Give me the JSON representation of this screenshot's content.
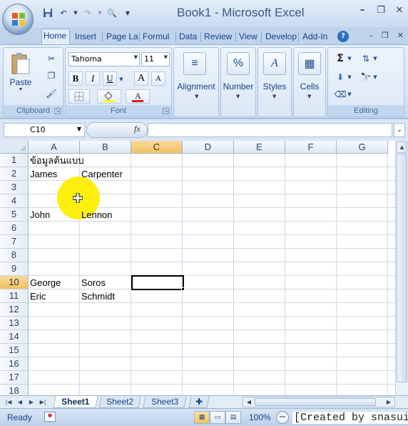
{
  "window": {
    "title": "Book1 - Microsoft Excel"
  },
  "ribbon_tabs": [
    "Home",
    "Insert",
    "Page La",
    "Formul",
    "Data",
    "Review",
    "View",
    "Develop",
    "Add-In"
  ],
  "ribbon": {
    "clipboard": {
      "paste_label": "Paste",
      "group_label": "Clipboard"
    },
    "font": {
      "font_name": "Tahoma",
      "font_size": "11",
      "group_label": "Font",
      "bold": "B",
      "italic": "I",
      "underline": "U",
      "grow": "A",
      "shrink": "A"
    },
    "alignment": {
      "label": "Alignment"
    },
    "number": {
      "label": "Number",
      "icon_text": "%"
    },
    "styles": {
      "label": "Styles"
    },
    "cells": {
      "label": "Cells"
    },
    "editing": {
      "group_label": "Editing",
      "sum_glyph": "Σ"
    }
  },
  "formula_bar": {
    "name_box": "C10",
    "fx_label": "fx",
    "formula": ""
  },
  "grid": {
    "columns": [
      "A",
      "B",
      "C",
      "D",
      "E",
      "F",
      "G"
    ],
    "selected_column": "C",
    "rows": [
      "1",
      "2",
      "3",
      "4",
      "5",
      "6",
      "7",
      "8",
      "9",
      "10",
      "11",
      "12",
      "13",
      "14",
      "15",
      "16",
      "17",
      "18"
    ],
    "selected_row": "10",
    "cells": {
      "A1": "ข้อมูลต้นแบบ",
      "A2": "James",
      "B2": "Carpenter",
      "A5": "John",
      "B5": "Lennon",
      "A10": "George",
      "B10": "Soros",
      "A11": "Eric",
      "B11": "Schmidt"
    }
  },
  "sheets": {
    "tabs": [
      "Sheet1",
      "Sheet2",
      "Sheet3"
    ],
    "active": "Sheet1"
  },
  "status": {
    "ready": "Ready",
    "zoom": "100%",
    "watermark": "[Created by snasui]"
  },
  "colors": {
    "accent": "#15428b",
    "selection_header": "#f1c15f",
    "highlight": "#ffee00"
  }
}
